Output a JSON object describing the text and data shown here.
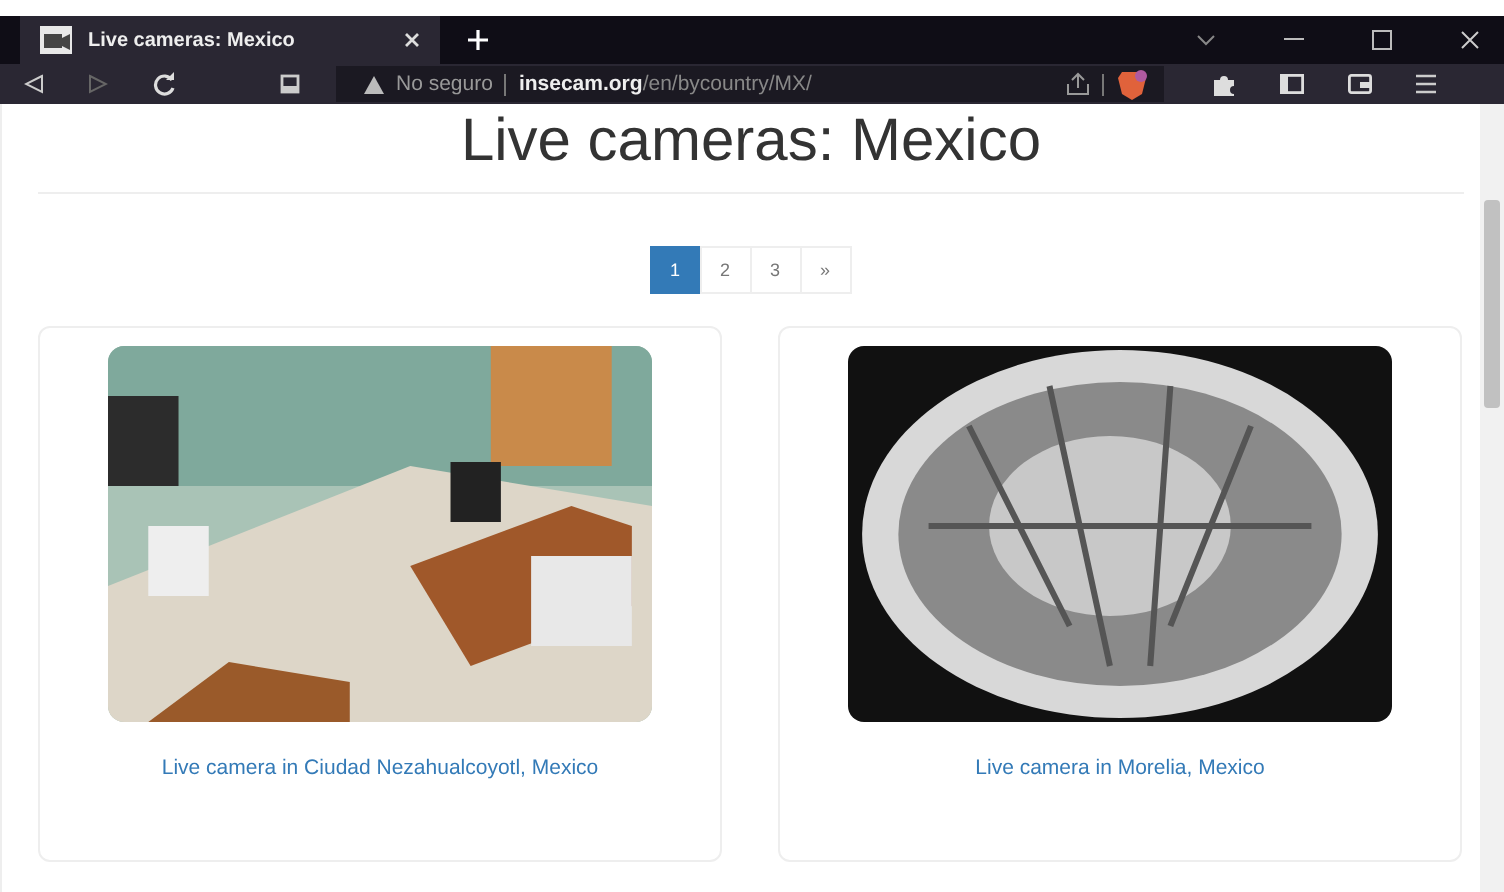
{
  "tab": {
    "title": "Live cameras: Mexico",
    "selected": true
  },
  "address": {
    "security": "No seguro",
    "domain": "insecam.org",
    "path": "/en/bycountry/MX/"
  },
  "heading": "Live cameras: Mexico",
  "pagination": [
    {
      "label": "1",
      "selected": true
    },
    {
      "label": "2",
      "selected": false
    },
    {
      "label": "3",
      "selected": false
    },
    {
      "label": "»",
      "selected": false
    }
  ],
  "cameras": [
    {
      "caption": "Live camera in Ciudad Nezahualcoyotl, Mexico",
      "kind": "office"
    },
    {
      "caption": "Live camera in Morelia, Mexico",
      "kind": "fisheye"
    }
  ]
}
